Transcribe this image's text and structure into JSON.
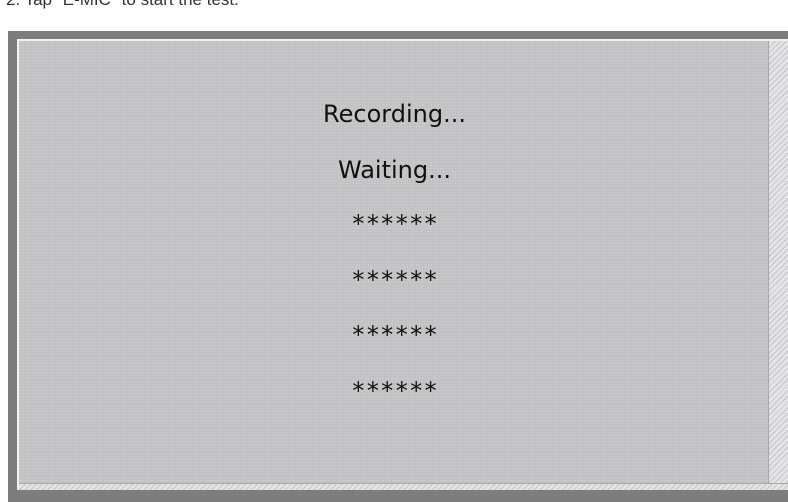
{
  "instruction": "2. Tap \"E-MIC\" to start the test.",
  "screen": {
    "status_recording": "Recording...",
    "status_waiting": "Waiting...",
    "results": [
      "******",
      "******",
      "******",
      "******"
    ]
  },
  "colors": {
    "frame": "#7d7d7d",
    "screen_bg": "#c2c2c4",
    "text": "#111111"
  }
}
